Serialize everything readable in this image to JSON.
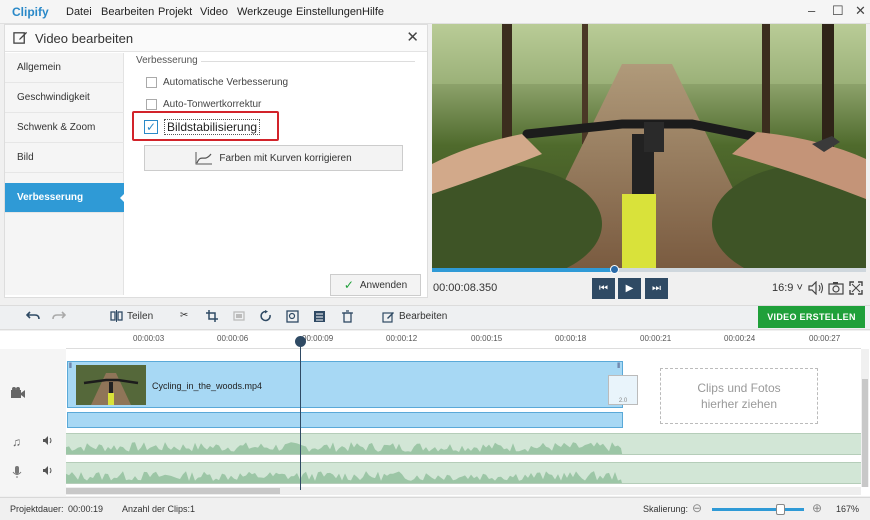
{
  "app": {
    "logo": "Clipify"
  },
  "menu": [
    "Datei",
    "Bearbeiten",
    "Projekt",
    "Video",
    "Werkzeuge",
    "Einstellungen",
    "Hilfe"
  ],
  "edit_panel": {
    "title": "Video bearbeiten",
    "nav": [
      "Allgemein",
      "Geschwindigkeit",
      "Schwenk & Zoom",
      "Bild",
      "Verbesserung"
    ],
    "active_nav": "Verbesserung",
    "section": "Verbesserung",
    "options": [
      {
        "label": "Automatische Verbesserung",
        "checked": false
      },
      {
        "label": "Auto-Tonwertkorrektur",
        "checked": false
      },
      {
        "label": "Bildstabilisierung",
        "checked": true
      }
    ],
    "curve_button": "Farben mit Kurven korrigieren",
    "apply_button": "Anwenden"
  },
  "player": {
    "timecode": "00:00:08.350",
    "aspect_ratio": "16:9",
    "progress": 0.42
  },
  "toolbar": {
    "split": "Teilen",
    "edit": "Bearbeiten",
    "create": "VIDEO ERSTELLEN"
  },
  "timeline": {
    "ticks": [
      "00:00:03",
      "00:00:06",
      "00:00:09",
      "00:00:12",
      "00:00:15",
      "00:00:18",
      "00:00:21",
      "00:00:24",
      "00:00:27"
    ],
    "clip_name": "Cycling_in_the_woods.mp4",
    "fx_badge": "2.0",
    "drop_zone": [
      "Clips und Fotos",
      "hierher ziehen"
    ]
  },
  "status": {
    "duration_label": "Projektdauer:",
    "duration_value": "00:00:19",
    "clips_label": "Anzahl der Clips:",
    "clips_value": "1",
    "scale_label": "Skalierung:",
    "zoom": "167%",
    "zoom_level": 0.74
  },
  "colors": {
    "accent": "#2f9ad6",
    "create_green": "#1fa03a",
    "highlight_red": "#d2232a",
    "clip_blue": "#a7d8f4",
    "audio_green": "#d2e6d6"
  }
}
